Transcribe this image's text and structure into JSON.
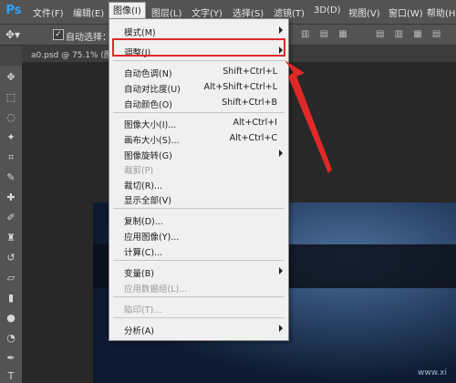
{
  "app": {
    "logo": "Ps"
  },
  "menubar": {
    "items": [
      "文件(F)",
      "编辑(E)",
      "图像(I)",
      "图层(L)",
      "文字(Y)",
      "选择(S)",
      "滤镜(T)",
      "3D(D)",
      "视图(V)",
      "窗口(W)",
      "帮助(H)"
    ]
  },
  "options": {
    "auto_select_label": "自动选择："
  },
  "document": {
    "tab_label": "a0.psd @ 75.1% (图"
  },
  "image_menu": {
    "items": [
      {
        "label": "模式(M)",
        "shortcut": ""
      },
      {
        "label": "调整(J)",
        "shortcut": ""
      },
      {
        "label": "自动色调(N)",
        "shortcut": "Shift+Ctrl+L"
      },
      {
        "label": "自动对比度(U)",
        "shortcut": "Alt+Shift+Ctrl+L"
      },
      {
        "label": "自动颜色(O)",
        "shortcut": "Shift+Ctrl+B"
      },
      {
        "label": "图像大小(I)...",
        "shortcut": "Alt+Ctrl+I"
      },
      {
        "label": "画布大小(S)...",
        "shortcut": "Alt+Ctrl+C"
      },
      {
        "label": "图像旋转(G)",
        "shortcut": ""
      },
      {
        "label": "裁剪(P)",
        "shortcut": ""
      },
      {
        "label": "裁切(R)...",
        "shortcut": ""
      },
      {
        "label": "显示全部(V)",
        "shortcut": ""
      },
      {
        "label": "复制(D)...",
        "shortcut": ""
      },
      {
        "label": "应用图像(Y)...",
        "shortcut": ""
      },
      {
        "label": "计算(C)...",
        "shortcut": ""
      },
      {
        "label": "变量(B)",
        "shortcut": ""
      },
      {
        "label": "应用数据组(L)...",
        "shortcut": ""
      },
      {
        "label": "陷印(T)...",
        "shortcut": ""
      },
      {
        "label": "分析(A)",
        "shortcut": ""
      }
    ]
  },
  "watermark": "www.xi"
}
